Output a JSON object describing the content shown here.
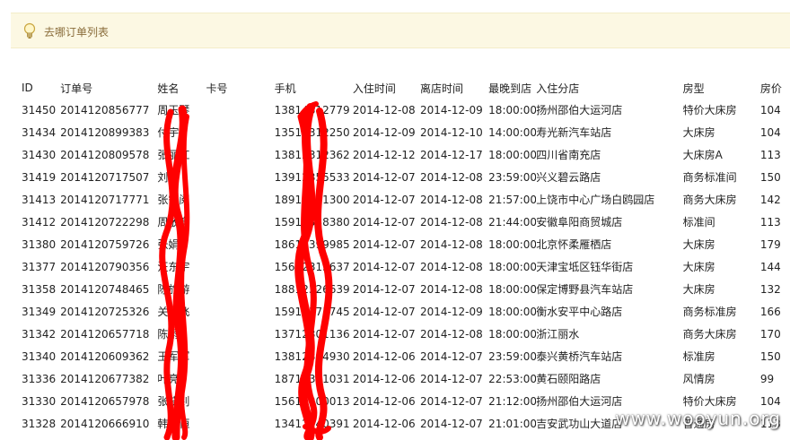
{
  "notice": {
    "title": "去哪订单列表",
    "icon": "lightbulb-icon",
    "accent": "#8a6d3b",
    "background": "#fcf8e3"
  },
  "table": {
    "headers": [
      "ID",
      "订单号",
      "姓名",
      "卡号",
      "手机",
      "入住时间",
      "离店时间",
      "最晚到店",
      "入住分店",
      "房型",
      "房价"
    ],
    "rows": [
      [
        "31450",
        "2014120856777",
        "周玉琴",
        "",
        "13814312779",
        "2014-12-08",
        "2014-12-09",
        "18:00:00",
        "扬州邵伯大运河店",
        "特价大床房",
        "104"
      ],
      [
        "31434",
        "2014120899383",
        "付宇",
        "",
        "13512312250",
        "2014-12-09",
        "2014-12-10",
        "14:00:00",
        "寿光新汽车站店",
        "大床房",
        "104"
      ],
      [
        "31430",
        "2014120809578",
        "张丽红",
        "",
        "13812312362",
        "2014-12-12",
        "2014-12-17",
        "18:00:00",
        "四川省南充店",
        "大床房A",
        "113"
      ],
      [
        "31419",
        "2014120717507",
        "刘刚",
        "",
        "13912355533",
        "2014-12-07",
        "2014-12-08",
        "23:59:00",
        "兴义碧云路店",
        "商务标准间",
        "150"
      ],
      [
        "31413",
        "2014120717771",
        "张智阅",
        "",
        "18912321300",
        "2014-12-07",
        "2014-12-08",
        "21:57:00",
        "上饶市中心广场白鸥园店",
        "商务大床房",
        "142"
      ],
      [
        "31412",
        "2014120722298",
        "周敬育",
        "",
        "15912338380",
        "2014-12-07",
        "2014-12-08",
        "21:44:00",
        "安徽阜阳商贸城店",
        "标准间",
        "113"
      ],
      [
        "31380",
        "2014120759726",
        "张娟",
        "",
        "18612399985",
        "2014-12-07",
        "2014-12-08",
        "18:00:00",
        "北京怀柔雁栖店",
        "大床房",
        "179"
      ],
      [
        "31377",
        "2014120790356",
        "汪东宇",
        "",
        "15612315637",
        "2014-12-07",
        "2014-12-08",
        "18:00:00",
        "天津宝坻区钰华街店",
        "大床房",
        "144"
      ],
      [
        "31358",
        "2014120748465",
        "陈旅游",
        "",
        "18812326639",
        "2014-12-07",
        "2014-12-08",
        "18:00:00",
        "保定博野县汽车站店",
        "大床房",
        "132"
      ],
      [
        "31349",
        "2014120725326",
        "关晨飞",
        "",
        "15912371745",
        "2014-12-07",
        "2014-12-09",
        "18:00:00",
        "衡水安平中心路店",
        "商务标准房",
        "166"
      ],
      [
        "31342",
        "2014120657718",
        "陈雨",
        "",
        "13712301136",
        "2014-12-07",
        "2014-12-08",
        "18:00:00",
        "浙江丽水",
        "商务大床房",
        "170"
      ],
      [
        "31340",
        "2014120609362",
        "王军军",
        "",
        "13812394930",
        "2014-12-06",
        "2014-12-07",
        "23:59:00",
        "泰兴黄桥汽车站店",
        "标准房",
        "150"
      ],
      [
        "31336",
        "2014120677382",
        "叶亮",
        "",
        "18712361031",
        "2014-12-06",
        "2014-12-07",
        "22:53:00",
        "黄石颐阳路店",
        "风情房",
        "99"
      ],
      [
        "31330",
        "2014120657978",
        "张晓钊",
        "",
        "15612300013",
        "2014-12-06",
        "2014-12-07",
        "21:12:00",
        "扬州邵伯大运河店",
        "特价大床房",
        "104"
      ],
      [
        "31328",
        "2014120666910",
        "韩恒恒",
        "",
        "13412340391",
        "2014-12-06",
        "2014-12-07",
        "21:01:00",
        "吉安武功山大道店",
        "普通房",
        "113"
      ]
    ]
  },
  "watermark": "www.wooyun.org",
  "colors": {
    "scribble": "#ff0000"
  }
}
